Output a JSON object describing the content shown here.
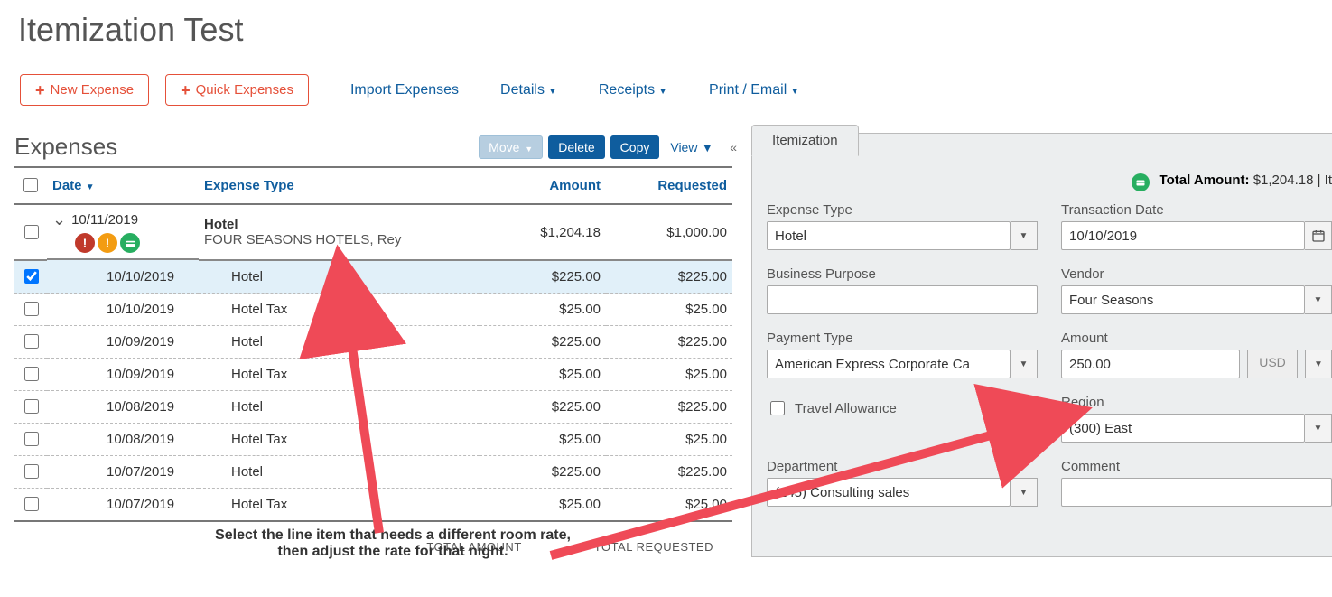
{
  "page": {
    "title": "Itemization Test"
  },
  "toolbar": {
    "new_expense": "New Expense",
    "quick_expenses": "Quick Expenses",
    "import_expenses": "Import Expenses",
    "details": "Details",
    "receipts": "Receipts",
    "print_email": "Print / Email"
  },
  "expenses": {
    "section_title": "Expenses",
    "actions": {
      "move": "Move",
      "delete": "Delete",
      "copy": "Copy",
      "view": "View"
    },
    "columns": {
      "date": "Date",
      "type": "Expense Type",
      "amount": "Amount",
      "requested": "Requested"
    },
    "parent": {
      "date": "10/11/2019",
      "type": "Hotel",
      "vendor": "FOUR SEASONS HOTELS, Rey",
      "amount": "$1,204.18",
      "requested": "$1,000.00"
    },
    "children": [
      {
        "date": "10/10/2019",
        "type": "Hotel",
        "amount": "$225.00",
        "requested": "$225.00",
        "selected": true
      },
      {
        "date": "10/10/2019",
        "type": "Hotel Tax",
        "amount": "$25.00",
        "requested": "$25.00"
      },
      {
        "date": "10/09/2019",
        "type": "Hotel",
        "amount": "$225.00",
        "requested": "$225.00"
      },
      {
        "date": "10/09/2019",
        "type": "Hotel Tax",
        "amount": "$25.00",
        "requested": "$25.00"
      },
      {
        "date": "10/08/2019",
        "type": "Hotel",
        "amount": "$225.00",
        "requested": "$225.00"
      },
      {
        "date": "10/08/2019",
        "type": "Hotel Tax",
        "amount": "$25.00",
        "requested": "$25.00"
      },
      {
        "date": "10/07/2019",
        "type": "Hotel",
        "amount": "$225.00",
        "requested": "$225.00"
      },
      {
        "date": "10/07/2019",
        "type": "Hotel Tax",
        "amount": "$25.00",
        "requested": "$25.00"
      }
    ],
    "totals": {
      "total_amount_label": "TOTAL AMOUNT",
      "total_requested_label": "TOTAL REQUESTED"
    }
  },
  "instruction": "Select the line item that needs a different room rate, then adjust the rate for that night.",
  "panel": {
    "tab": "Itemization",
    "total_label": "Total Amount:",
    "total_value": "$1,204.18",
    "total_suffix": "| It",
    "fields": {
      "expense_type": {
        "label": "Expense Type",
        "value": "Hotel"
      },
      "transaction_date": {
        "label": "Transaction Date",
        "value": "10/10/2019"
      },
      "business_purpose": {
        "label": "Business Purpose",
        "value": ""
      },
      "vendor": {
        "label": "Vendor",
        "value": "Four Seasons"
      },
      "payment_type": {
        "label": "Payment Type",
        "value": "American Express Corporate Ca"
      },
      "amount": {
        "label": "Amount",
        "value": "250.00",
        "currency": "USD"
      },
      "travel_allowance": {
        "label": "Travel Allowance",
        "checked": false
      },
      "region": {
        "label": "Region",
        "value": "(300) East"
      },
      "department": {
        "label": "Department",
        "value": "(245) Consulting sales"
      },
      "comment": {
        "label": "Comment",
        "value": ""
      }
    }
  }
}
